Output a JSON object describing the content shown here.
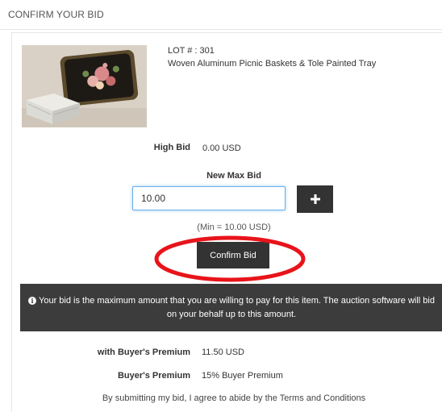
{
  "header": {
    "title": "CONFIRM YOUR BID"
  },
  "lot": {
    "number": "LOT # : 301",
    "title": "Woven Aluminum Picnic Baskets & Tole Painted Tray"
  },
  "high_bid": {
    "label": "High Bid",
    "value": "0.00 USD"
  },
  "new_max_bid": {
    "label": "New Max Bid",
    "input_value": "10.00",
    "increment_icon": "plus-icon",
    "min_note": "(Min = 10.00 USD)"
  },
  "confirm_button": {
    "label": "Confirm Bid"
  },
  "notice": {
    "icon": "info-icon",
    "text": "Your bid is the maximum amount that you are willing to pay for this item. The auction software will bid on your behalf up to this amount."
  },
  "summary": {
    "with_premium_label": "with Buyer's Premium",
    "with_premium_value": "11.50 USD",
    "premium_label": "Buyer's Premium",
    "premium_value": "15% Buyer Premium"
  },
  "terms": "By submitting my bid, I agree to abide by the Terms and Conditions",
  "colors": {
    "dark_button": "#333333",
    "notice_background": "#3c3c3c",
    "input_focus_border": "#66afe9",
    "annotation_ellipse": "#e8141a"
  }
}
